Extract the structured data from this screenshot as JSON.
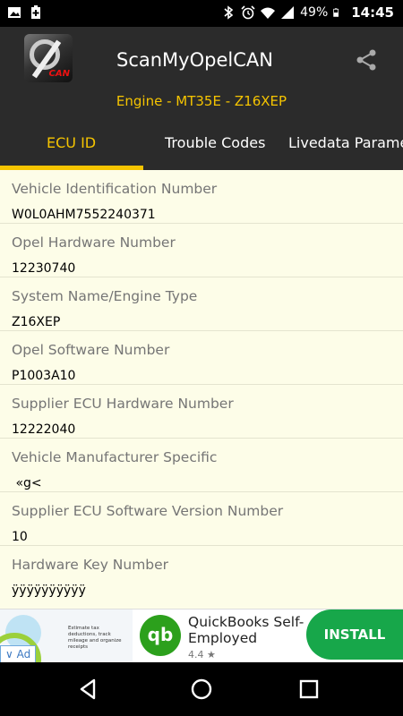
{
  "status_bar": {
    "battery": "49%",
    "time": "14:45"
  },
  "app": {
    "logo_text": "CAN",
    "title": "ScanMyOpelCAN",
    "subtitle": "Engine - MT35E - Z16XEP"
  },
  "tabs": [
    {
      "label": "ECU ID",
      "active": true
    },
    {
      "label": "Trouble Codes",
      "active": false
    },
    {
      "label": "Livedata Parame",
      "active": false
    }
  ],
  "ecu_fields": [
    {
      "label": "Vehicle Identification Number",
      "value": "W0L0AHM7552240371"
    },
    {
      "label": "Opel Hardware Number",
      "value": "12230740"
    },
    {
      "label": "System Name/Engine Type",
      "value": "Z16XEP"
    },
    {
      "label": "Opel Software Number",
      "value": "P1003A10"
    },
    {
      "label": "Supplier ECU Hardware Number",
      "value": "12222040"
    },
    {
      "label": "Vehicle Manufacturer Specific",
      "value": " «g<"
    },
    {
      "label": "Supplier ECU Software Version Number",
      "value": "10"
    },
    {
      "label": "Hardware Key Number",
      "value": "ÿÿÿÿÿÿÿÿÿÿ"
    }
  ],
  "ad": {
    "thumb_text": "Estimate tax deductions, track mileage and organize receipts",
    "badge": "Ad",
    "logo_text": "qb",
    "title": "QuickBooks Self-Employed",
    "rating": "4.4 ★",
    "install_label": "INSTALL"
  },
  "colors": {
    "accent": "#f5c400",
    "header_bg": "#2b2b2b",
    "row_bg": "#fdfde8",
    "install": "#17a74a"
  }
}
